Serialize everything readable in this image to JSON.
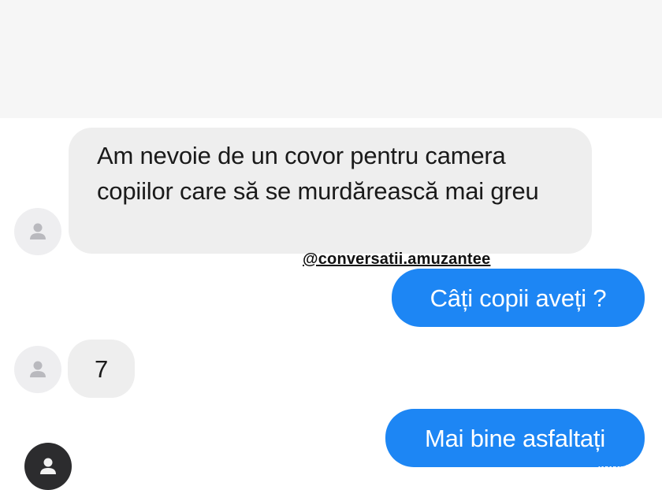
{
  "watermark": "@conversatii.amuzantee",
  "site_mark": "www.2lol.ro",
  "messages": [
    {
      "sender": "other",
      "text": "Am nevoie de un covor pentru camera copiilor care să se murdărească mai greu"
    },
    {
      "sender": "me",
      "text": "Câți copii aveți ?"
    },
    {
      "sender": "other",
      "text": "7"
    },
    {
      "sender": "me",
      "text": "Mai bine asfaltați"
    }
  ],
  "colors": {
    "outgoing": "#1d86f4",
    "incoming": "#eeeeee",
    "avatar": "#eeeef0",
    "avatar_dark": "#2c2c2e"
  },
  "icons": [
    "user-avatar-icon"
  ]
}
